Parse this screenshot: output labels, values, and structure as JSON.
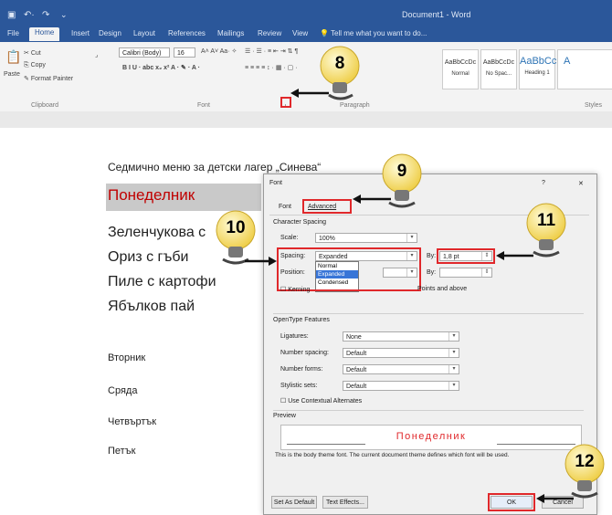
{
  "word": {
    "doc_title": "Document1 - Word",
    "tell_me": "Tell me what you want to do...",
    "tabs": [
      "File",
      "Home",
      "Insert",
      "Design",
      "Layout",
      "References",
      "Mailings",
      "Review",
      "View"
    ],
    "clipboard": {
      "cut": "Cut",
      "copy": "Copy",
      "paste": "Paste",
      "format_painter": "Format Painter",
      "label": "Clipboard"
    },
    "font_group": {
      "font_name": "Calibri (Body)",
      "font_size": "16",
      "label": "Font"
    },
    "paragraph_label": "Paragraph",
    "styles": [
      {
        "preview": "AaBbCcDc",
        "name": "Normal"
      },
      {
        "preview": "AaBbCcDc",
        "name": "No Spac..."
      },
      {
        "preview": "AaBbCc",
        "name": "Heading 1"
      },
      {
        "preview": "A",
        "name": ""
      }
    ],
    "styles_label": "Styles"
  },
  "document": {
    "heading": "Седмично меню за детски лагер „Синева“",
    "day1": "Понеделник",
    "items": [
      "Зеленчукова с",
      "Ориз с гъби",
      "Пиле с картофи",
      "Ябълков пай"
    ],
    "days": [
      "Вторник",
      "Сряда",
      "Четвъртък",
      "Петък"
    ]
  },
  "dialog": {
    "title": "Font",
    "help": "?",
    "close": "✕",
    "tab_font": "Font",
    "tab_advanced": "Advanced",
    "section_spacing": "Character Spacing",
    "scale_label": "Scale:",
    "scale_value": "100%",
    "spacing_label": "Spacing:",
    "spacing_value": "Expanded",
    "spacing_options": [
      "Normal",
      "Expanded",
      "Condensed"
    ],
    "position_label": "Position:",
    "by_label": "By:",
    "by_value": "1,8 pt",
    "by2_label": "By:",
    "kerning_label": "Kerning",
    "kerning_suffix": "Points and above",
    "section_opentype": "OpenType Features",
    "ligatures_label": "Ligatures:",
    "ligatures_value": "None",
    "num_spacing_label": "Number spacing:",
    "num_spacing_value": "Default",
    "num_forms_label": "Number forms:",
    "num_forms_value": "Default",
    "stylistic_label": "Stylistic sets:",
    "stylistic_value": "Default",
    "contextual_label": "Use Contextual Alternates",
    "section_preview": "Preview",
    "preview_text": "Понеделник",
    "preview_desc": "This is the body theme font. The current document theme defines which font will be used.",
    "btn_default": "Set As Default",
    "btn_effects": "Text Effects...",
    "btn_ok": "OK",
    "btn_cancel": "Cancel"
  },
  "callouts": [
    "8",
    "9",
    "10",
    "11",
    "12"
  ],
  "colors": {
    "word_blue": "#2b579a",
    "callout_red": "#e0282b",
    "heading_red": "#c00000",
    "bulb_yellow": "#f6e27a"
  }
}
